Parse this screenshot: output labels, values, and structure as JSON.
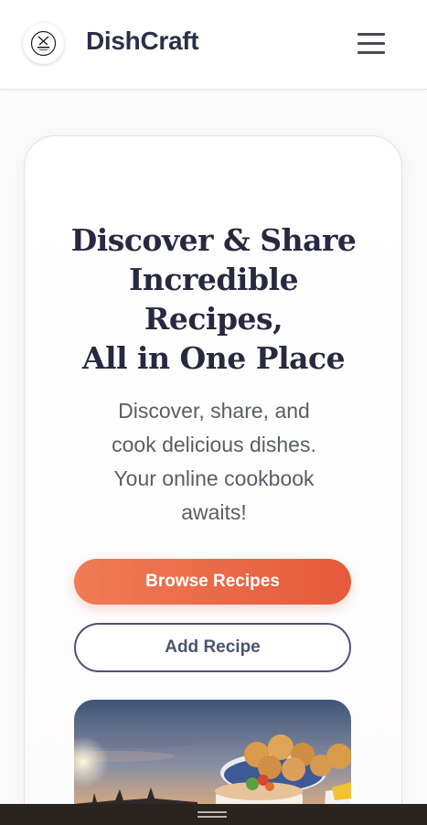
{
  "header": {
    "brand": "DishCraft",
    "logo_icon": "chef-logo-icon",
    "menu_icon": "hamburger-menu-icon"
  },
  "hero": {
    "title_lines": [
      "Discover & Share",
      "Incredible",
      "Recipes,",
      "All in One Place"
    ],
    "subtitle_lines": [
      "Discover, share, and",
      "cook delicious dishes.",
      "Your online cookbook",
      "awaits!"
    ],
    "primary_button": "Browse Recipes",
    "secondary_button": "Add Recipe",
    "image_subject": "food-bowls-at-sunset"
  },
  "colors": {
    "accent": "#e9673f",
    "text_dark": "#272a3f",
    "outline": "#4b5470"
  }
}
